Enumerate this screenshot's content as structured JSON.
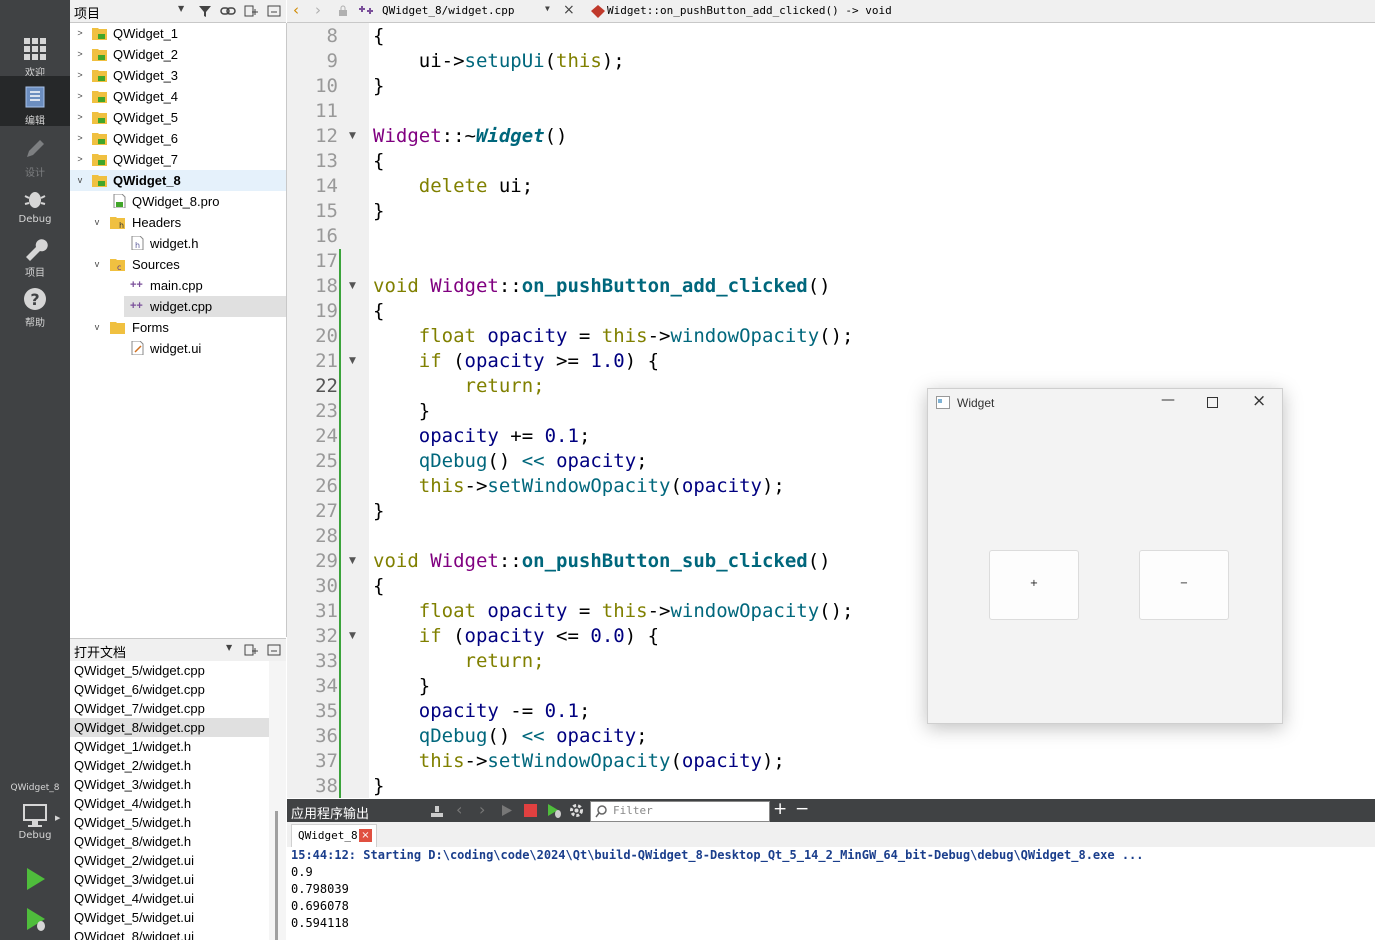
{
  "modes": [
    {
      "label": "欢迎",
      "icon": "grid-icon"
    },
    {
      "label": "编辑",
      "icon": "edit-doc-icon"
    },
    {
      "label": "设计",
      "icon": "pencil-icon"
    },
    {
      "label": "Debug",
      "icon": "bug-icon"
    },
    {
      "label": "项目",
      "icon": "wrench-icon"
    },
    {
      "label": "帮助",
      "icon": "help-icon"
    }
  ],
  "kit": {
    "project": "QWidget_8",
    "label": "Debug"
  },
  "project_pane": {
    "title": "项目",
    "items": [
      {
        "label": "QWidget_1"
      },
      {
        "label": "QWidget_2"
      },
      {
        "label": "QWidget_3"
      },
      {
        "label": "QWidget_4"
      },
      {
        "label": "QWidget_5"
      },
      {
        "label": "QWidget_6"
      },
      {
        "label": "QWidget_7"
      },
      {
        "label": "QWidget_8"
      },
      {
        "label": "QWidget_8.pro"
      },
      {
        "label": "Headers"
      },
      {
        "label": "widget.h"
      },
      {
        "label": "Sources"
      },
      {
        "label": "main.cpp"
      },
      {
        "label": "widget.cpp"
      },
      {
        "label": "Forms"
      },
      {
        "label": "widget.ui"
      }
    ]
  },
  "open_docs": {
    "title": "打开文档",
    "items": [
      "QWidget_5/widget.cpp",
      "QWidget_6/widget.cpp",
      "QWidget_7/widget.cpp",
      "QWidget_8/widget.cpp",
      "QWidget_1/widget.h",
      "QWidget_2/widget.h",
      "QWidget_3/widget.h",
      "QWidget_4/widget.h",
      "QWidget_5/widget.h",
      "QWidget_8/widget.h",
      "QWidget_2/widget.ui",
      "QWidget_3/widget.ui",
      "QWidget_4/widget.ui",
      "QWidget_5/widget.ui",
      "QWidget_8/widget.ui"
    ]
  },
  "editor": {
    "file": "QWidget_8/widget.cpp",
    "symbol": "Widget::on_pushButton_add_clicked() -> void",
    "line_numbers": [
      "8",
      "9",
      "10",
      "11",
      "12",
      "13",
      "14",
      "15",
      "16",
      "17",
      "18",
      "19",
      "20",
      "21",
      "22",
      "23",
      "24",
      "25",
      "26",
      "27",
      "28",
      "29",
      "30",
      "31",
      "32",
      "33",
      "34",
      "35",
      "36",
      "37",
      "38"
    ],
    "current_line": "22"
  },
  "code": {
    "l8": "{",
    "l9_a": "    ui->",
    "l9_b": "setupUi",
    "l9_c": "(",
    "l9_d": "this",
    "l9_e": ");",
    "l10": "}",
    "l12_a": "Widget",
    "l12_b": "::~",
    "l12_c": "Widget",
    "l12_d": "()",
    "l13": "{",
    "l14_a": "    delete ",
    "l14_b": "ui;",
    "l15": "}",
    "l18_a": "void ",
    "l18_b": "Widget",
    "l18_c": "::",
    "l18_d": "on_pushButton_add_clicked",
    "l18_e": "()",
    "l19": "{",
    "l20_a": "    float ",
    "l20_b": "opacity",
    "l20_c": " = ",
    "l20_d": "this",
    "l20_e": "->",
    "l20_f": "windowOpacity",
    "l20_g": "();",
    "l21_a": "    if ",
    "l21_b": "(",
    "l21_c": "opacity",
    "l21_d": " >= ",
    "l21_e": "1.0",
    "l21_f": ") {",
    "l22": "        return;",
    "l23": "    }",
    "l24_a": "    ",
    "l24_b": "opacity",
    "l24_c": " += ",
    "l24_d": "0.1",
    "l24_e": ";",
    "l25_a": "    ",
    "l25_b": "qDebug",
    "l25_c": "() ",
    "l25_d": "<<",
    "l25_e": " opacity",
    ";": ";",
    "l25_f": ";",
    "l26_a": "    this",
    "l26_b": "->",
    "l26_c": "setWindowOpacity",
    "l26_d": "(",
    "l26_e": "opacity",
    "l26_f": ");",
    "l27": "}",
    "l29_a": "void ",
    "l29_b": "Widget",
    "l29_c": "::",
    "l29_d": "on_pushButton_sub_clicked",
    "l29_e": "()",
    "l30": "{",
    "l31_a": "    float ",
    "l31_b": "opacity",
    "l31_c": " = ",
    "l31_d": "this",
    "l31_e": "->",
    "l31_f": "windowOpacity",
    "l31_g": "();",
    "l32_a": "    if ",
    "l32_b": "(",
    "l32_c": "opacity",
    "l32_d": " <= ",
    "l32_e": "0.0",
    "l32_f": ") {",
    "l33": "        return;",
    "l34": "    }",
    "l35_a": "    ",
    "l35_b": "opacity",
    "l35_c": " -= ",
    "l35_d": "0.1",
    "l35_e": ";",
    "l36_a": "    ",
    "l36_b": "qDebug",
    "l36_c": "() ",
    "l36_d": "<<",
    "l36_e": " opacity",
    "l36_f": ";",
    "l37_a": "    this",
    "l37_b": "->",
    "l37_c": "setWindowOpacity",
    "l37_d": "(",
    "l37_e": "opacity",
    "l37_f": ");",
    "l38": "}"
  },
  "widget_window": {
    "title": "Widget",
    "add_label": "+",
    "sub_label": "−"
  },
  "output": {
    "title": "应用程序输出",
    "filter_placeholder": "Filter",
    "tab": "QWidget_8",
    "lines": [
      "15:44:12: Starting D:\\coding\\code\\2024\\Qt\\build-QWidget_8-Desktop_Qt_5_14_2_MinGW_64_bit-Debug\\debug\\QWidget_8.exe ...",
      "0.9",
      "0.798039",
      "0.696078",
      "0.594118"
    ]
  },
  "colors": {
    "keyword": "#808000",
    "type": "#800080",
    "function": "#00677c",
    "number": "#000080",
    "status_blue": "#1a3e8c"
  }
}
